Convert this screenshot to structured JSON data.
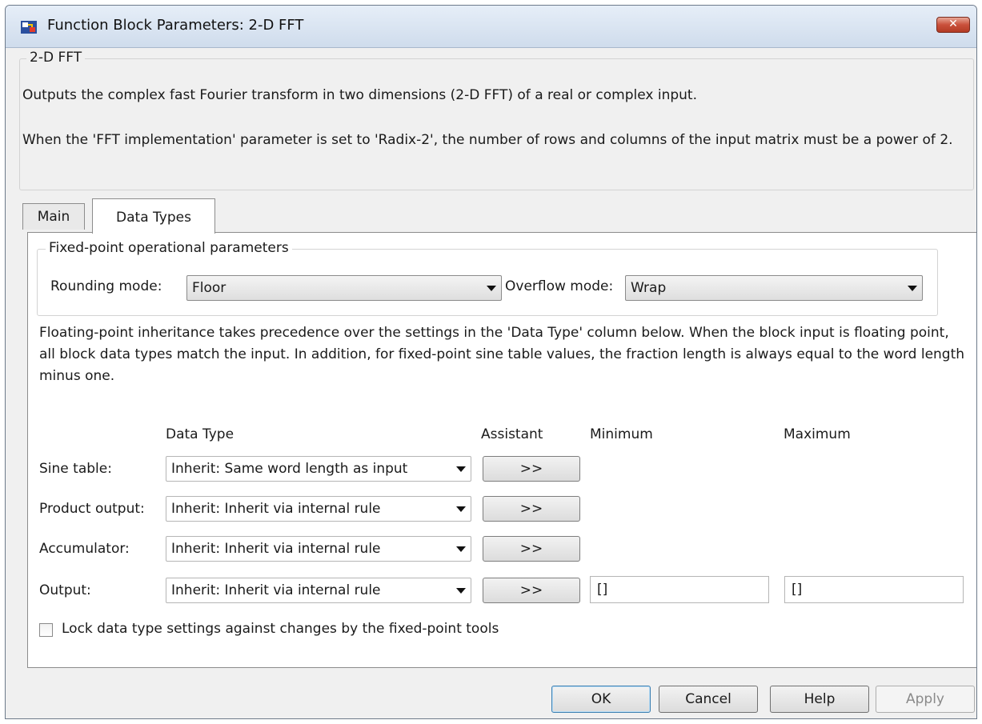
{
  "window": {
    "title": "Function Block Parameters: 2-D FFT",
    "close_label": "✕"
  },
  "block": {
    "group_title": "2-D FFT",
    "description_1": "Outputs the complex fast Fourier transform in two dimensions (2-D FFT) of a real or complex input.",
    "description_2": "When the 'FFT implementation' parameter is set to 'Radix-2', the number of rows and columns of the input matrix must be a power of 2."
  },
  "tabs": [
    {
      "label": "Main",
      "active": false
    },
    {
      "label": "Data Types",
      "active": true
    }
  ],
  "fixed_point": {
    "group_title": "Fixed-point operational parameters",
    "rounding_label": "Rounding mode:",
    "rounding_value": "Floor",
    "overflow_label": "Overflow mode:",
    "overflow_value": "Wrap"
  },
  "info_text": "Floating-point inheritance takes precedence over the settings in the 'Data Type' column below. When the block input is floating point, all block data types match the input. In addition, for fixed-point sine table values, the fraction length is always equal to the word length minus one.",
  "columns": {
    "data_type": "Data Type",
    "assistant": "Assistant",
    "minimum": "Minimum",
    "maximum": "Maximum"
  },
  "rows": [
    {
      "label": "Sine table:",
      "data_type": "Inherit: Same word length as input",
      "assistant": ">>"
    },
    {
      "label": "Product output:",
      "data_type": "Inherit: Inherit via internal rule",
      "assistant": ">>"
    },
    {
      "label": "Accumulator:",
      "data_type": "Inherit: Inherit via internal rule",
      "assistant": ">>"
    },
    {
      "label": "Output:",
      "data_type": "Inherit: Inherit via internal rule",
      "assistant": ">>",
      "minimum": "[]",
      "maximum": "[]"
    }
  ],
  "lock": {
    "label": "Lock data type settings against changes by the fixed-point tools",
    "checked": false
  },
  "buttons": {
    "ok": "OK",
    "cancel": "Cancel",
    "help": "Help",
    "apply": "Apply"
  }
}
